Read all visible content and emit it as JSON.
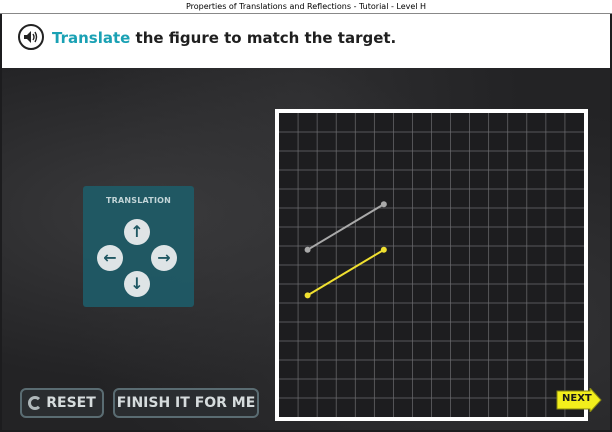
{
  "window": {
    "title": "Properties of Translations and Reflections - Tutorial - Level H"
  },
  "instruction": {
    "keyword": "Translate",
    "rest": " the figure to match the target."
  },
  "translation_panel": {
    "title": "TRANSLATION",
    "arrows": {
      "up": "↑",
      "left": "←",
      "right": "→",
      "down": "↓"
    }
  },
  "grid": {
    "cells": 16,
    "segments": [
      {
        "role": "target",
        "color": "#a9a9a9",
        "from": [
          1.5,
          8.8
        ],
        "to": [
          5.5,
          11.2
        ]
      },
      {
        "role": "figure",
        "color": "#f0e030",
        "from": [
          1.5,
          6.4
        ],
        "to": [
          5.5,
          8.8
        ]
      }
    ]
  },
  "buttons": {
    "reset": "RESET",
    "finish": "FINISH IT FOR ME",
    "next": "NEXT"
  },
  "colors": {
    "accent": "#1aa1b4",
    "panel": "#1f5a66",
    "next": "#f2ee1c"
  }
}
